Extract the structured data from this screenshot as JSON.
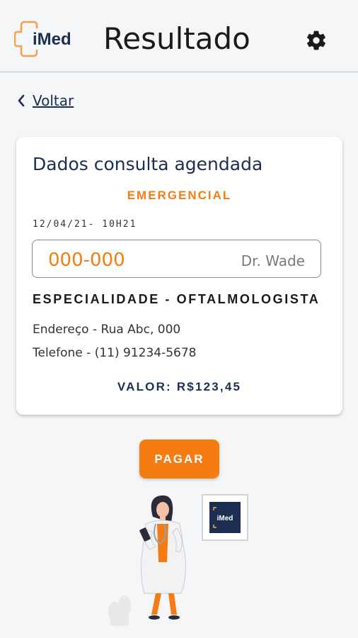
{
  "header": {
    "logo_text": "iMed",
    "title": "Resultado",
    "settings_icon": "gear-icon"
  },
  "nav": {
    "back_label": "Voltar",
    "back_icon": "chevron-left-icon"
  },
  "card": {
    "title": "Dados consulta agendada",
    "priority": "EMERGENCIAL",
    "datetime": "12/04/21- 10H21",
    "code": "000-000",
    "doctor": "Dr. Wade",
    "specialty": "ESPECIALIDADE - OFTALMOLOGISTA",
    "address": "Endereço - Rua Abc, 000",
    "phone": "Telefone - (11) 91234-5678",
    "value": "VALOR: R$123,45"
  },
  "actions": {
    "pay_label": "PAGAR"
  },
  "illustration": {
    "board_text": "iMed"
  },
  "colors": {
    "accent": "#f57c13",
    "navy": "#1c2f52",
    "background": "#f4f6f8"
  }
}
